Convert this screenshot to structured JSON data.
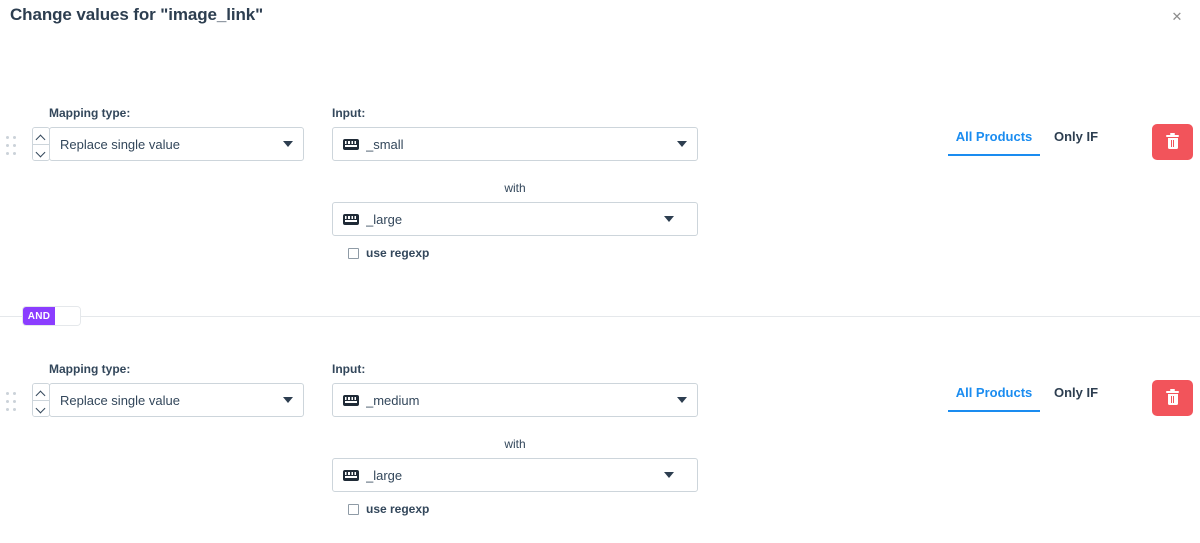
{
  "header": {
    "title": "Change values for \"image_link\"",
    "close_label": "✕"
  },
  "labels": {
    "mapping_type": "Mapping type:",
    "input": "Input:",
    "with": "with",
    "use_regexp": "use regexp"
  },
  "scope_tabs": {
    "all_products": "All Products",
    "only_if": "Only IF",
    "active": "All Products"
  },
  "separator": {
    "logic_active": "AND",
    "logic_inactive": ""
  },
  "colors": {
    "accent_blue": "#1a8cf0",
    "delete_red": "#f2545b",
    "logic_purple": "#8b3dff",
    "border_gray": "#cdd5db",
    "text_dark": "#33475b"
  },
  "rules": [
    {
      "mapping_type": "Replace single value",
      "input_value": "_small",
      "with_value": "_large",
      "use_regexp_checked": false
    },
    {
      "mapping_type": "Replace single value",
      "input_value": "_medium",
      "with_value": "_large",
      "use_regexp_checked": false
    }
  ]
}
